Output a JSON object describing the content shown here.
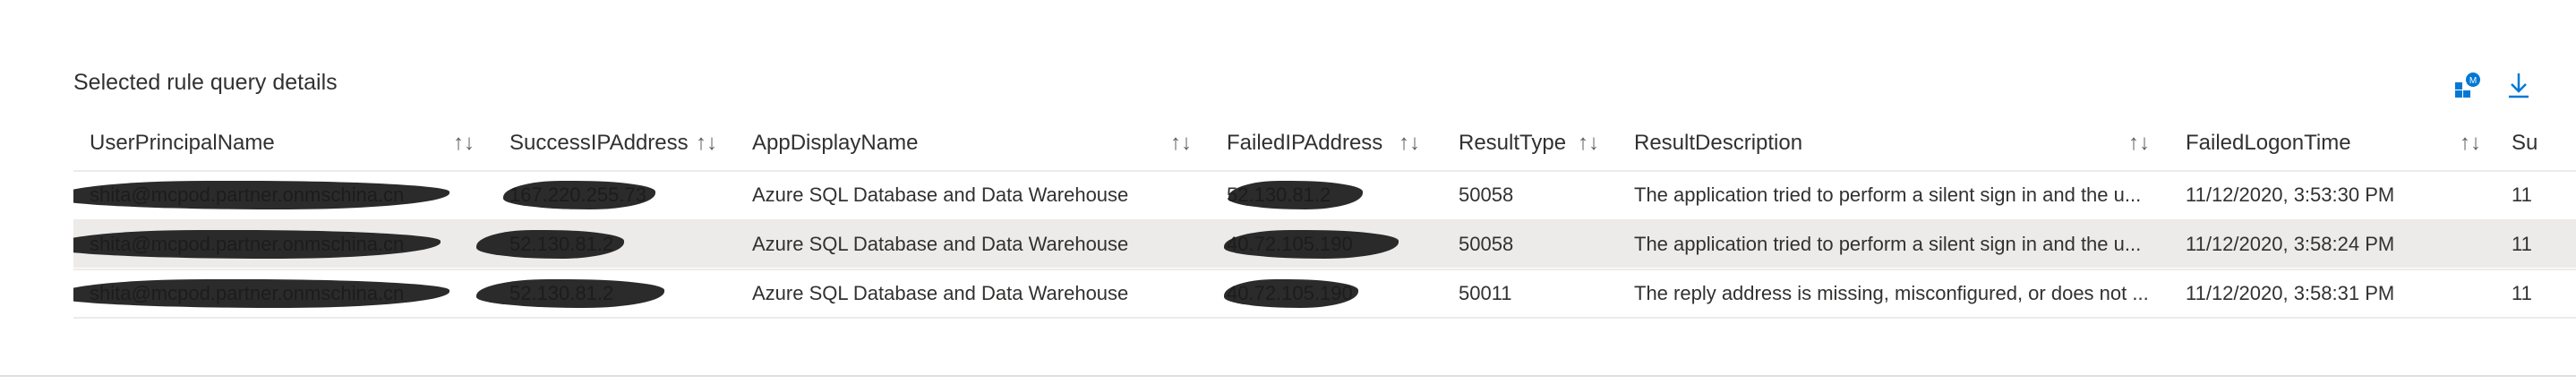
{
  "title": "Selected rule query details",
  "toolbar": {
    "icon_a": "query-analytics-icon",
    "icon_b": "download-icon"
  },
  "sort_glyph": "↑↓",
  "columns": [
    {
      "label": "UserPrincipalName"
    },
    {
      "label": "SuccessIPAddress"
    },
    {
      "label": "AppDisplayName"
    },
    {
      "label": "FailedIPAddress"
    },
    {
      "label": "ResultType"
    },
    {
      "label": "ResultDescription"
    },
    {
      "label": "FailedLogonTime"
    },
    {
      "label": "Su"
    }
  ],
  "rows": [
    {
      "user": "shita@mcpod.partner.onmschina.cn",
      "success_ip": "167.220.255.73",
      "app": "Azure SQL Database and Data Warehouse",
      "failed_ip": "52.130.81.2",
      "result_type": "50058",
      "result_desc": "The application tried to perform a silent sign in and the u...",
      "failed_time": "11/12/2020, 3:53:30 PM",
      "extra": "11"
    },
    {
      "user": "shita@mcpod.partner.onmschina.cn",
      "success_ip": "52.130.81.2",
      "app": "Azure SQL Database and Data Warehouse",
      "failed_ip": "40.72.105.190",
      "result_type": "50058",
      "result_desc": "The application tried to perform a silent sign in and the u...",
      "failed_time": "11/12/2020, 3:58:24 PM",
      "extra": "11"
    },
    {
      "user": "shita@mcpod.partner.onmschina.cn",
      "success_ip": "52.130.81.2",
      "app": "Azure SQL Database and Data Warehouse",
      "failed_ip": "40.72.105.190",
      "result_type": "50011",
      "result_desc": "The reply address is missing, misconfigured, or does not ...",
      "failed_time": "11/12/2020, 3:58:31 PM",
      "extra": "11"
    }
  ],
  "colors": {
    "selected_row": "#edebe9",
    "accent": "#0078d4",
    "border": "#edebe9"
  }
}
